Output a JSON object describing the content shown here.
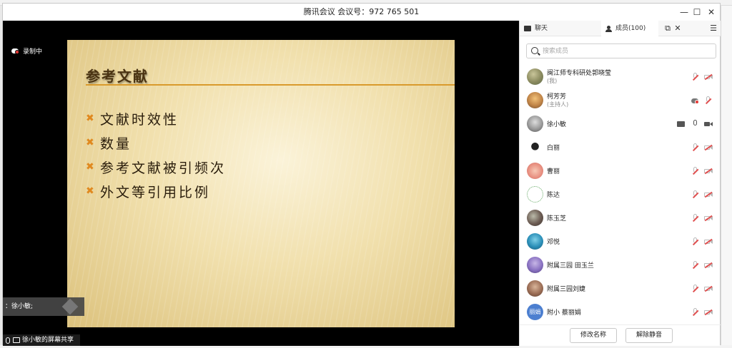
{
  "window": {
    "title": "腾讯会议 会议号：972 765 501",
    "controls": {
      "minimize": "—",
      "maximize": "☐",
      "close": "✕"
    }
  },
  "video": {
    "recording_label": "录制中",
    "slide": {
      "title": "参考文献",
      "bullet_marker": "✖",
      "bullets": [
        "文献时效性",
        "数量",
        "参考文献被引频次",
        "外文等引用比例"
      ]
    },
    "speaking_label": "：徐小敏;",
    "share_label": "徐小敏的屏幕共享"
  },
  "panel": {
    "tabs": {
      "chat": "聊天",
      "members": "成员(100)",
      "popout": "⧉",
      "close": "✕",
      "menu": "☰"
    },
    "search_placeholder": "搜索成员",
    "members": [
      {
        "name": "闽江师专科研处郭晓莹",
        "role": "(我)"
      },
      {
        "name": "柯芳芳",
        "role": "(主持人)"
      },
      {
        "name": "徐小敏",
        "role": ""
      },
      {
        "name": "白丽",
        "role": ""
      },
      {
        "name": "曹丽",
        "role": ""
      },
      {
        "name": "陈达",
        "role": ""
      },
      {
        "name": "陈玉芝",
        "role": ""
      },
      {
        "name": "邓悦",
        "role": ""
      },
      {
        "name": "附属三园 田玉兰",
        "role": ""
      },
      {
        "name": "附属三园刘婕",
        "role": ""
      },
      {
        "name": "附小 蔡丽娟",
        "role": "",
        "avatar_text": "丽娟"
      }
    ],
    "buttons": {
      "rename": "修改名称",
      "unmute": "解除静音"
    }
  },
  "colors": {
    "accent_orange": "#d99a2c",
    "mute_red": "#e05050",
    "slide_bg": "#f1e0ad"
  }
}
